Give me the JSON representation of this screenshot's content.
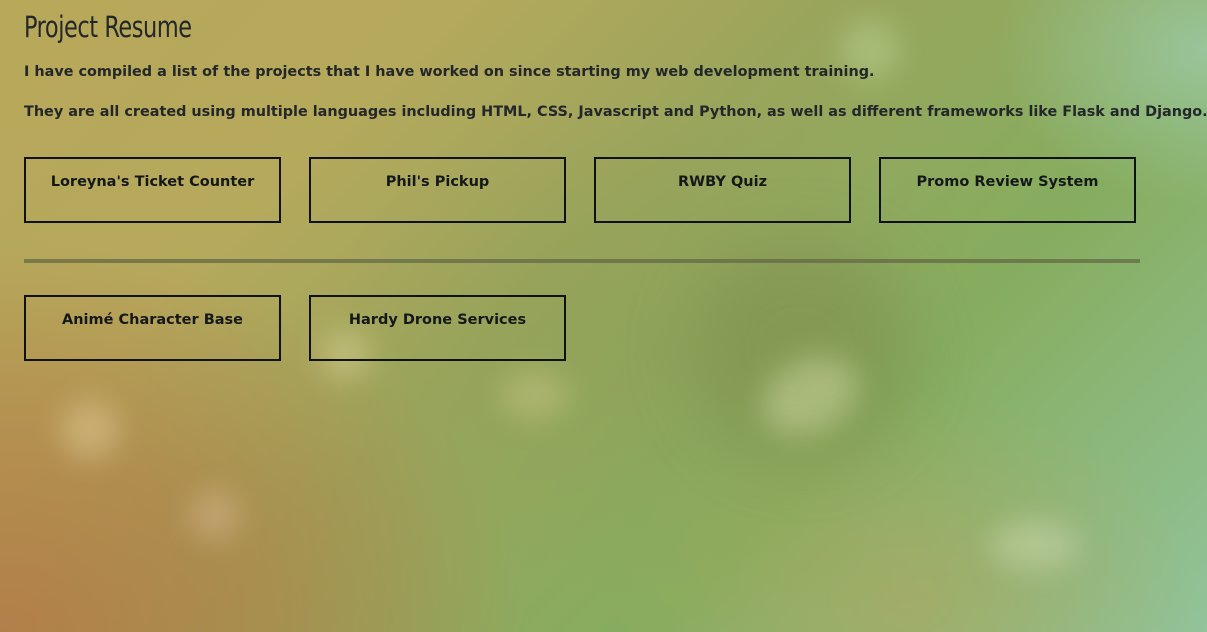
{
  "page": {
    "title": "Project Resume",
    "intro": [
      "I have compiled a list of the projects that I have worked on since starting my web development training.",
      "They are all created using multiple languages including HTML, CSS, Javascript and Python, as well as different frameworks like Flask and Django."
    ]
  },
  "projects": [
    {
      "label": "Loreyna's Ticket Counter"
    },
    {
      "label": "Phil's Pickup"
    },
    {
      "label": "RWBY Quiz"
    },
    {
      "label": "Promo Review System"
    },
    {
      "label": "Animé Character Base"
    },
    {
      "label": "Hardy Drone Services"
    }
  ],
  "colors": {
    "text": "#232729",
    "card_border": "#0f1112",
    "divider": "#6a6b4a"
  }
}
